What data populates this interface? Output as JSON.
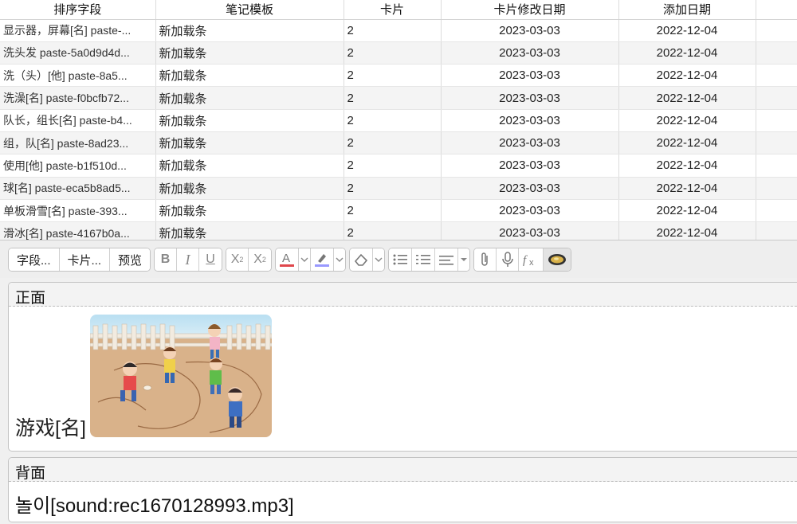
{
  "table": {
    "headers": [
      "排序字段",
      "笔记模板",
      "卡片",
      "卡片修改日期",
      "添加日期"
    ],
    "rows": [
      {
        "sort": "显示器，屏幕[名] paste-...",
        "template": "新加载条",
        "cards": "2",
        "modified": "2023-03-03",
        "added": "2022-12-04"
      },
      {
        "sort": "洗头发 paste-5a0d9d4d...",
        "template": "新加载条",
        "cards": "2",
        "modified": "2023-03-03",
        "added": "2022-12-04"
      },
      {
        "sort": "洗（头）[他] paste-8a5...",
        "template": "新加载条",
        "cards": "2",
        "modified": "2023-03-03",
        "added": "2022-12-04"
      },
      {
        "sort": "洗澡[名] paste-f0bcfb72...",
        "template": "新加载条",
        "cards": "2",
        "modified": "2023-03-03",
        "added": "2022-12-04"
      },
      {
        "sort": "队长，组长[名] paste-b4...",
        "template": "新加载条",
        "cards": "2",
        "modified": "2023-03-03",
        "added": "2022-12-04"
      },
      {
        "sort": "组，队[名] paste-8ad23...",
        "template": "新加载条",
        "cards": "2",
        "modified": "2023-03-03",
        "added": "2022-12-04"
      },
      {
        "sort": "使用[他] paste-b1f510d...",
        "template": "新加载条",
        "cards": "2",
        "modified": "2023-03-03",
        "added": "2022-12-04"
      },
      {
        "sort": "球[名] paste-eca5b8ad5...",
        "template": "新加载条",
        "cards": "2",
        "modified": "2023-03-03",
        "added": "2022-12-04"
      },
      {
        "sort": "单板滑雪[名] paste-393...",
        "template": "新加载条",
        "cards": "2",
        "modified": "2023-03-03",
        "added": "2022-12-04"
      },
      {
        "sort": "滑冰[名] paste-4167b0a...",
        "template": "新加载条",
        "cards": "2",
        "modified": "2023-03-03",
        "added": "2022-12-04"
      }
    ]
  },
  "toolbar": {
    "fields_label": "字段...",
    "cards_label": "卡片...",
    "preview_label": "预览",
    "bold": "B",
    "italic": "I",
    "underline": "U",
    "text_color_accent": "#e0474c",
    "highlight_accent": "#9999ff",
    "icons": [
      "superscript-icon",
      "subscript-icon",
      "text-color-icon",
      "highlight-icon",
      "eraser-icon",
      "bullet-list-icon",
      "numbered-list-icon",
      "align-icon",
      "paperclip-icon",
      "microphone-icon",
      "formula-icon",
      "speaker-addon-icon"
    ]
  },
  "editor": {
    "front_label": "正面",
    "front_text": "游戏[名]",
    "back_label": "背面",
    "back_text": "놀이[sound:rec1670128993.mp3]"
  }
}
